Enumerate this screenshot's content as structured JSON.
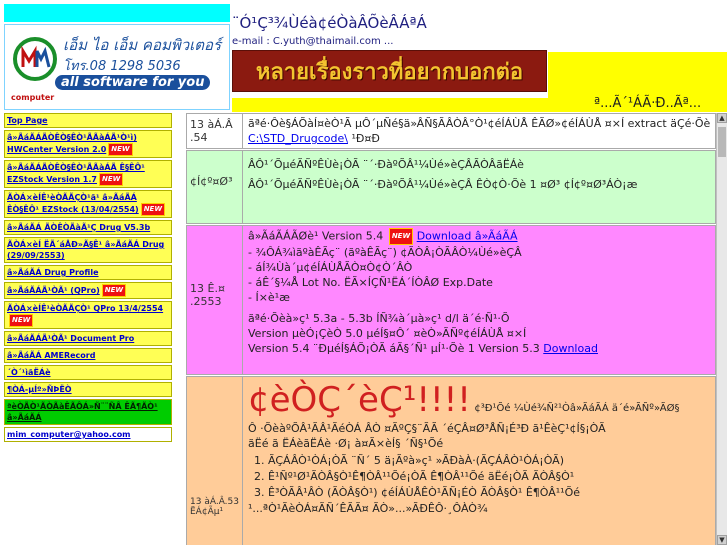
{
  "header": {
    "logo_brand": "เอ็ม ไอ เอ็ม คอมพิวเตอร์",
    "logo_phone": "โทร.08 1298 5036",
    "logo_slogan": "all software for you",
    "logo_sub": "computer",
    "title": "¨Ó¹Ç³¾Ùéà¢éÒàÂÕèÂÁªÁ",
    "email": "e-mail : C.yuth@thaimail.com ...",
    "banner": "หลายเรื่องราวที่อยากบอกต่อ",
    "yellow_text": "ª...Ã´¹ÁÃ·Ð..Ãª..."
  },
  "sidebar": {
    "items": [
      {
        "label": "Top Page",
        "new": false,
        "style": "yellow"
      },
      {
        "label": "â»ÃáÃÁÃÒÊÒ§ÊÒ¹ÃÃàÁÃ¹Ò¹ì) HWCenter Version 2.0",
        "new": true,
        "style": "yellow"
      },
      {
        "label": "â»ÃáÃÁÃÒÊÒ§ÊÒ¹ÃÃàÁÃ Ê§ÊÔ¹ EZStock Version 1.7",
        "new": true,
        "style": "yellow"
      },
      {
        "label": "ÃÒÁ×èÍÊ¹èÒÃÃÇÒ¹ã¹ â»ÃáÃÁ ÊÒ§ÊÔ¹ EZStock (13/04/2554)",
        "new": true,
        "style": "yellow"
      },
      {
        "label": "â»ÃáÃÁ ÃÒÊÒÃàÃ¹Ç Drug V5.3b",
        "new": false,
        "style": "yellow"
      },
      {
        "label": "ÃÒÁ×èÍ ËÃ´áÅÐ»Ã§Ê¹ â»ÃáÃÁ Drug (29/09/2553)",
        "new": false,
        "style": "yellow"
      },
      {
        "label": "â»ÃáÃÁ Drug Profile",
        "new": false,
        "style": "yellow"
      },
      {
        "label": "â»ÃáÃÁÃ¹ÒÃ¹ (QPro)",
        "new": true,
        "style": "yellow"
      },
      {
        "label": "ÃÒÁ×èÍÊ¹èÒÃÃÇÒ¹ QPro 13/4/2554",
        "new": true,
        "style": "yellow"
      },
      {
        "label": "â»ÃáÃÁÃ¹ÒÃ¹ Document Pro",
        "new": false,
        "style": "yellow"
      },
      {
        "label": "â»ÃáÃÁ AMERecord",
        "new": false,
        "style": "yellow"
      },
      {
        "label": "´Ò´¹ìãËÁè",
        "new": false,
        "style": "yellow"
      },
      {
        "label": "¶ÒÁ-µÍº»ÑÞËÒ",
        "new": false,
        "style": "yellow"
      },
      {
        "label": "ªèÒÃÒ¹ÃÒÃàÊÃÔÁ»Ñ¨¨ÑÂ ÊÃ¶ÃÒ¹ â»ÃáÃÁ",
        "new": false,
        "style": "green"
      },
      {
        "label": "mim_computer@yahoo.com",
        "new": false,
        "style": "plain"
      }
    ],
    "new_badge": "NEW"
  },
  "main": {
    "row1": {
      "date": "13 àÁ.Â .54",
      "text": "ãªé·Ôè§ÁÕàÍ¤èÒ¹Ã µÔ´µÑé§ä»ÂÑ§ÃÂÒÂ°Ò¹¢éÍÁÙÅ ÊÃØ»¢éÍÁÙÅ ¤×Í extract äÇé·Õè",
      "link": "C:\\STD_Drugcode\\",
      "tail": "¹Ð¤Ð"
    },
    "row2": {
      "date": "¢Í¢º¤Ø³",
      "line1": "ÂÔ¹´Õµé͹ÃÑºÊÙè¡ÒÃ ¨´·ÐàºÕÂ¹¼Ùé»èÇÂÃÒÂãËÁè",
      "line2": "ÂÔ¹´Õµé͹ÃÑºÊÙè¡ÒÃ ¨´·ÐàºÕÂ¹¼Ùé»èÇÂ ÊÒ¢Ò·Õè 1 ¤Ø³ ¢Í¢º¤Ø³ÁÒ¡æ"
    },
    "row3": {
      "date": "13 Ê.¤ .2553",
      "bullet1": "â»ÃáÃÁÃØè¹ Version 5.4",
      "bullet1_link": "Download â»ÃáÃÁ",
      "bullet2": "- ¾ÔÁ¾ìãºàÊÃç¨ (ãºàÊÃç¨) ¢ÃÒÂ¡ÒÃÂÒ¼Ùé»èÇÂ",
      "bullet3": "- áÍ¾Ùà´µ¢éÍÁÙÅÃÒ¤Ò¢Ò´ÂÒ",
      "bullet4": "- áÊ´§¼Å Lot No. ËÃ×ÍÇÑ¹ËÁ´ÍÒÂØ Exp.Date",
      "bullet5": "- Í×è¹æ",
      "para1": "ãªé·Õèà»ç¹ 5.3a - 5.3b ÍÑ¾à´µà»ç¹ d/l ä´é·Ñ¹·Õ",
      "para2": "Version µèÓ¡ÇèÒ 5.0 µéÍ§¤Ô´ ¤èÒ»ÃÑº¢éÍÁÙÅ ¤×Í",
      "para3": "Version 5.4 ¨ÐµéÍ§ÁÕ¡ÒÃ áÃ§´Ñ¹ µÍ¹·Õè 1 Version 5.3",
      "link2": "Download"
    },
    "row4": {
      "date": "13 àÁ.Â.53 ËÁ¢Ãµ¹",
      "big": "¢èÒÇ´èÇ¹!!!!",
      "intro": "¢³Ð¹Õé ¼Ùé¾Ñ²¹Òâ»ÃáÃÁ ä´é»ÃÑº»ÃØ§",
      "intro2": "Ô ·ÕèàºÕÂ¹ÃÂ¹ÃéÒÁ ÂÒ ¤ÃºÇ§¨ÃÃ ´éÇÂ¤Ø³ÅÑ¡É³Ð ã¹ÊèÇ¹¢Í§¡ÒÃ",
      "intro3": "ãËé ã ËÁèãËÁè ·Ø¡ à¤Ã×èÍ§ ´Ñ§¹Õé",
      "items": [
        "ÃÇÁÂÒ¹ÒÁ¡ÒÃ ¨Ñ´ 5 ä¡Ãºà»ç¹ »ÃÐàÀ·(ÃÇÁÂÒ¹ÒÁ¡ÒÃ)",
        "Ê¹Ñº¹Ø¹ÃÒÂ§Ò¹Ê¶ÒÂ¹¹Õé¡ÒÃ Ê¶ÒÂ¹¹Õé ãËé¡ÒÃ ÃÒÂ§Ò¹",
        "Ê³ÒÃÂ¹ÂÒ (ÃÒÂ§Ò¹) ¢éÍÁÙÅÊÒ¹ÃÑ¡ÉÒ ÃÒÂ§Ò¹ Ê¶ÒÂ¹¹Õé"
      ],
      "tail": "¹...ªÒ¹ÃèÒÁ¤ÃÑ´ÊÃÃ¤ ÃÒ»...»ÃÐÊÔ·¸ÔÀÒ¾"
    }
  },
  "colors": {
    "cyan": "#00ffff",
    "yellow": "#ffff00",
    "row1": "#ffffff",
    "row2": "#ccffcc",
    "row3": "#ff88ff",
    "row4": "#ffcc99"
  }
}
